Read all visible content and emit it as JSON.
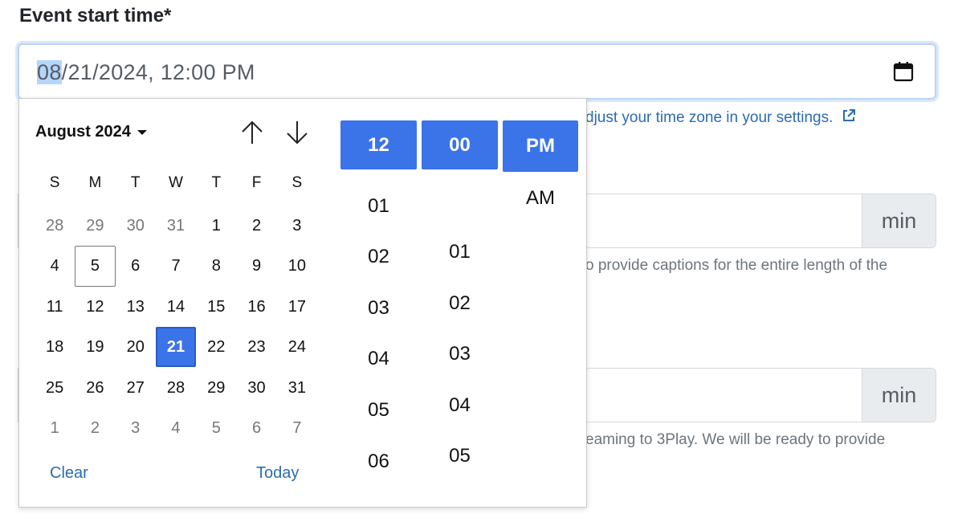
{
  "field": {
    "label": "Event start time*",
    "value_month": "08",
    "value_rest": "/21/2024, 12:00 PM"
  },
  "help_link": "djust your time zone in your settings.",
  "inputs": [
    {
      "addon": "min",
      "help": "o provide captions for the entire length of the"
    },
    {
      "addon": "min",
      "help": "eaming to 3Play. We will be ready to provide"
    }
  ],
  "picker": {
    "month_label": "August 2024",
    "weekdays": [
      "S",
      "M",
      "T",
      "W",
      "T",
      "F",
      "S"
    ],
    "weeks": [
      [
        "28",
        "29",
        "30",
        "31",
        "1",
        "2",
        "3"
      ],
      [
        "4",
        "5",
        "6",
        "7",
        "8",
        "9",
        "10"
      ],
      [
        "11",
        "12",
        "13",
        "14",
        "15",
        "16",
        "17"
      ],
      [
        "18",
        "19",
        "20",
        "21",
        "22",
        "23",
        "24"
      ],
      [
        "25",
        "26",
        "27",
        "28",
        "29",
        "30",
        "31"
      ],
      [
        "1",
        "2",
        "3",
        "4",
        "5",
        "6",
        "7"
      ]
    ],
    "clear_label": "Clear",
    "today_label": "Today",
    "hour_selected": "12",
    "hours": [
      "01",
      "02",
      "03",
      "04",
      "05",
      "06"
    ],
    "minute_selected": "00",
    "minutes": [
      "01",
      "02",
      "03",
      "04",
      "05"
    ],
    "ampm_selected": "PM",
    "ampm_options": [
      "AM"
    ]
  },
  "colors": {
    "accent": "#3b73e8",
    "link": "#2b6cb0",
    "focus_border": "#b9d4f5",
    "addon_bg": "#e9ecef"
  },
  "icons": {
    "calendar": "calendar-icon",
    "external_link": "external-link-icon",
    "caret": "caret-down-icon",
    "up": "arrow-up-icon",
    "down": "arrow-down-icon"
  }
}
